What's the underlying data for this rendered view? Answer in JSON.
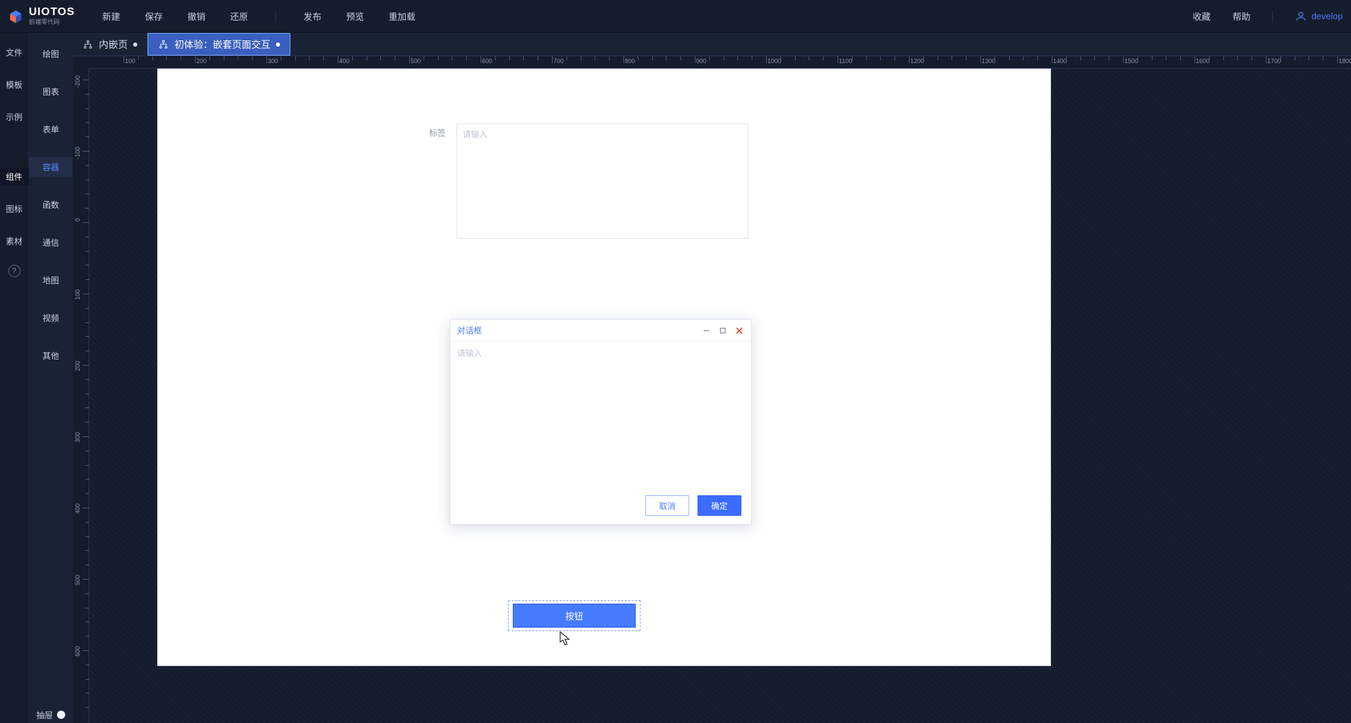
{
  "brand": {
    "name": "UIOTOS",
    "tagline": "前端零代码"
  },
  "toolbar": {
    "new": "新建",
    "save": "保存",
    "undo": "撤销",
    "redo": "还原",
    "publish": "发布",
    "preview": "预览",
    "reload": "重加载",
    "favorite": "收藏",
    "help": "帮助"
  },
  "user": "develop",
  "rail": {
    "file": "文件",
    "template": "模板",
    "example": "示例",
    "component": "组件",
    "icon": "图标",
    "asset": "素材"
  },
  "components": {
    "drawing": "绘图",
    "chart": "图表",
    "form": "表单",
    "container": "容器",
    "function": "函数",
    "comm": "通信",
    "map": "地图",
    "video": "视频",
    "other": "其他"
  },
  "drawer_label": "抽屉",
  "tabs": {
    "t1": "内嵌页",
    "t2": "初体验：嵌套页面交互"
  },
  "page": {
    "label": "标签",
    "textarea_placeholder": "请输入",
    "dialog": {
      "title": "对话框",
      "body_placeholder": "请输入",
      "cancel": "取消",
      "ok": "确定"
    },
    "button": "按钮"
  },
  "rulers": {
    "h": [
      "100",
      "200",
      "300",
      "400",
      "500",
      "600",
      "700",
      "800",
      "900",
      "1000",
      "1100",
      "1200",
      "1300",
      "1400",
      "1500",
      "1600",
      "1700",
      "1800"
    ],
    "v": [
      "-200",
      "-100",
      "0",
      "100",
      "200",
      "300",
      "400",
      "500",
      "600"
    ]
  }
}
